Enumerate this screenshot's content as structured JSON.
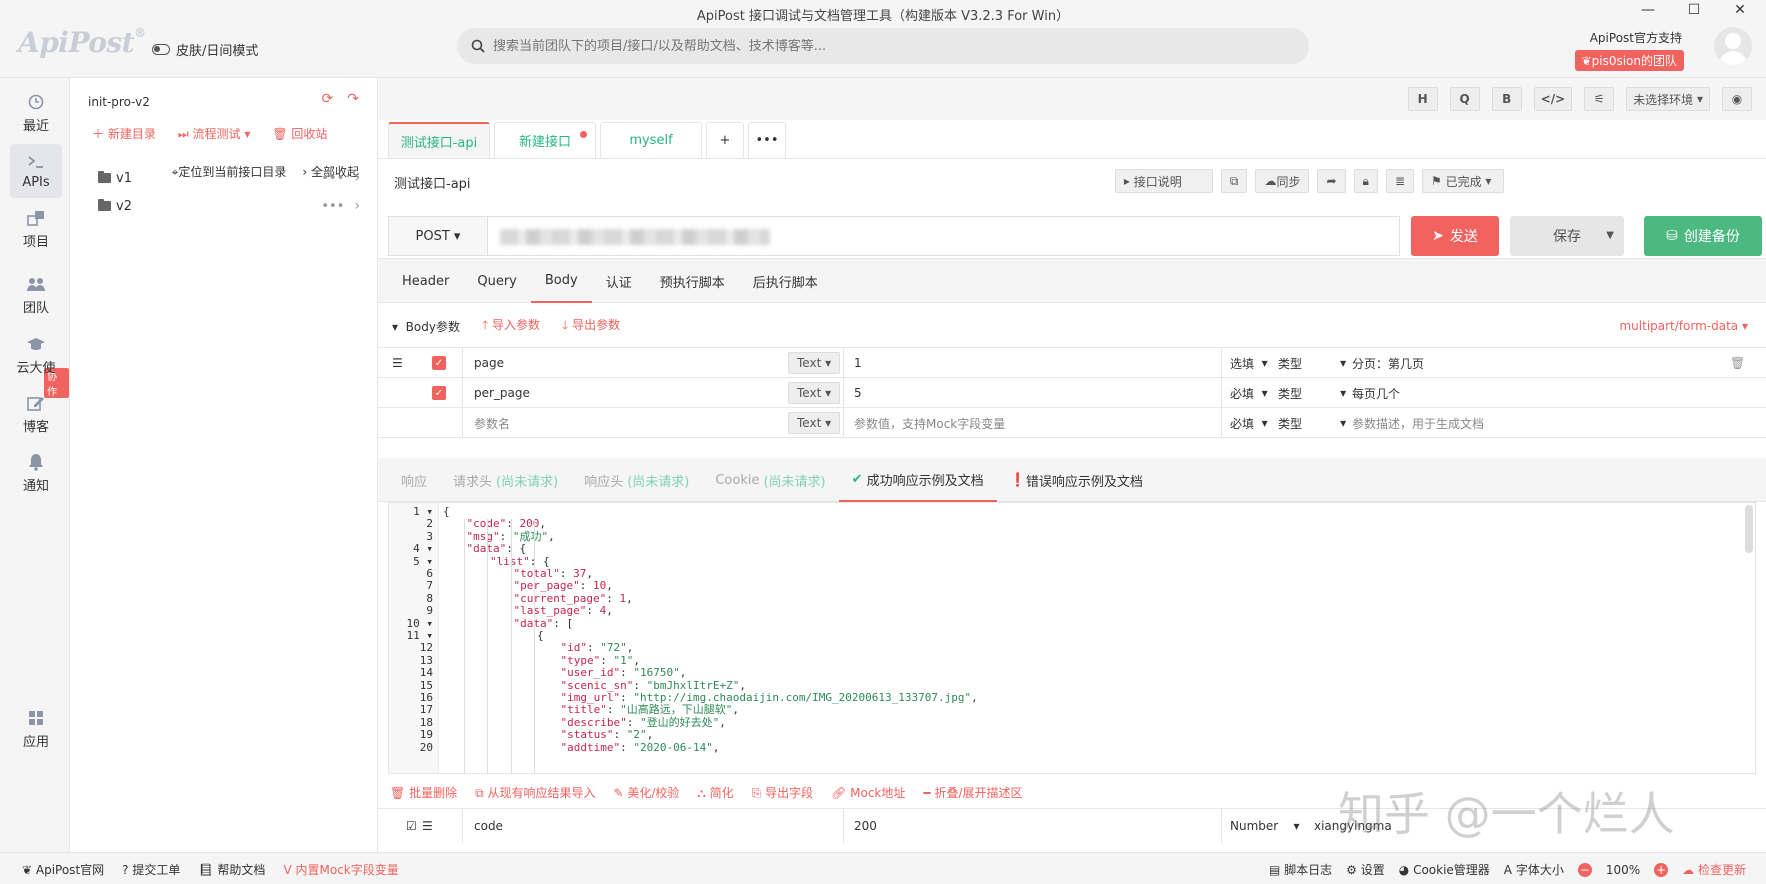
{
  "window": {
    "title": "ApiPost 接口调试与文档管理工具（构建版本 V3.2.3 For Win）",
    "controls": [
      "—",
      "☐",
      "✕"
    ]
  },
  "header": {
    "logo": "ApiPost",
    "logo_mark": "®",
    "theme_toggle": "皮肤/日间模式",
    "search_placeholder": "搜索当前团队下的项目/接口/以及帮助文档、技术博客等...",
    "support": "ApiPost官方支持",
    "team": "pis0sion的团队"
  },
  "leftnav": {
    "items": [
      {
        "label": "最近",
        "icon": "clock-icon"
      },
      {
        "label": "APIs",
        "icon": "terminal-icon"
      },
      {
        "label": "项目",
        "icon": "project-icon"
      },
      {
        "label": "团队",
        "icon": "team-icon"
      },
      {
        "label": "云大使",
        "icon": "graduation-icon"
      },
      {
        "label": "博客",
        "icon": "edit-icon"
      },
      {
        "label": "通知",
        "icon": "bell-icon"
      },
      {
        "label": "应用",
        "icon": "grid-icon"
      }
    ],
    "collab_badge": "协作"
  },
  "tree": {
    "project": "init-pro-v2",
    "actions": {
      "new_dir": "新建目录",
      "flow_test": "流程测试",
      "recycle": "回收站"
    },
    "locate": "定位到当前接口目录",
    "collapse_all": "全部收起",
    "folders": [
      "v1",
      "v2"
    ]
  },
  "main": {
    "toolbar": {
      "h": "H",
      "q": "Q",
      "b": "B",
      "code": "</>",
      "sliders": "⚟",
      "env": "未选择环境",
      "eye": "◉"
    },
    "tabs": [
      {
        "label": "测试接口-api"
      },
      {
        "label": "新建接口"
      },
      {
        "label": "myself"
      }
    ],
    "tab_add": "+",
    "tab_more": "•••",
    "api_title": "测试接口-api",
    "api_tools": {
      "desc": "接口说明",
      "sync": "同步",
      "status": "已完成"
    },
    "method": "POST",
    "send": "发送",
    "save": "保存",
    "backup": "创建备份",
    "subtabs": [
      "Header",
      "Query",
      "Body",
      "认证",
      "预执行脚本",
      "后执行脚本"
    ],
    "body_bar": {
      "params": "Body参数",
      "import": "导入参数",
      "export": "导出参数",
      "content_type": "multipart/form-data"
    },
    "params": [
      {
        "name": "page",
        "type": "Text",
        "value": "1",
        "required": "选填",
        "field_type": "类型",
        "desc": "分页：第几页"
      },
      {
        "name": "per_page",
        "type": "Text",
        "value": "5",
        "required": "必填",
        "field_type": "类型",
        "desc": "每页几个"
      },
      {
        "name": "参数名",
        "type": "Text",
        "value": "参数值，支持Mock字段变量",
        "required": "必填",
        "field_type": "类型",
        "desc": "参数描述，用于生成文档"
      }
    ],
    "resp_tabs": [
      {
        "label": "响应",
        "sub": ""
      },
      {
        "label": "请求头",
        "sub": "(尚未请求)"
      },
      {
        "label": "响应头",
        "sub": "(尚未请求)"
      },
      {
        "label": "Cookie",
        "sub": "(尚未请求)"
      },
      {
        "label": "成功响应示例及文档",
        "sub": ""
      },
      {
        "label": "错误响应示例及文档",
        "sub": ""
      }
    ],
    "code_lines": [
      {
        "n": "1",
        "fold": true,
        "d": 0,
        "k": "",
        "v": "",
        "raw": "{"
      },
      {
        "n": "2",
        "fold": false,
        "d": 1,
        "k": "\"code\"",
        "v": "200",
        "t": "n"
      },
      {
        "n": "3",
        "fold": false,
        "d": 1,
        "k": "\"msg\"",
        "v": "\"成功\"",
        "t": "s"
      },
      {
        "n": "4",
        "fold": true,
        "d": 1,
        "k": "\"data\"",
        "v": "{",
        "t": "p"
      },
      {
        "n": "5",
        "fold": true,
        "d": 2,
        "k": "\"list\"",
        "v": "{",
        "t": "p"
      },
      {
        "n": "6",
        "fold": false,
        "d": 3,
        "k": "\"total\"",
        "v": "37",
        "t": "n"
      },
      {
        "n": "7",
        "fold": false,
        "d": 3,
        "k": "\"per_page\"",
        "v": "10",
        "t": "n"
      },
      {
        "n": "8",
        "fold": false,
        "d": 3,
        "k": "\"current_page\"",
        "v": "1",
        "t": "n"
      },
      {
        "n": "9",
        "fold": false,
        "d": 3,
        "k": "\"last_page\"",
        "v": "4",
        "t": "n"
      },
      {
        "n": "10",
        "fold": true,
        "d": 3,
        "k": "\"data\"",
        "v": "[",
        "t": "p"
      },
      {
        "n": "11",
        "fold": true,
        "d": 4,
        "k": "",
        "v": "",
        "raw": "{"
      },
      {
        "n": "12",
        "fold": false,
        "d": 5,
        "k": "\"id\"",
        "v": "\"72\"",
        "t": "s"
      },
      {
        "n": "13",
        "fold": false,
        "d": 5,
        "k": "\"type\"",
        "v": "\"1\"",
        "t": "s"
      },
      {
        "n": "14",
        "fold": false,
        "d": 5,
        "k": "\"user_id\"",
        "v": "\"16750\"",
        "t": "s"
      },
      {
        "n": "15",
        "fold": false,
        "d": 5,
        "k": "\"scenic_sn\"",
        "v": "\"bmJhxlItrE+Z\"",
        "t": "s"
      },
      {
        "n": "16",
        "fold": false,
        "d": 5,
        "k": "\"img_url\"",
        "v": "\"http://img.chaodaijin.com/IMG_20200613_133707.jpg\"",
        "t": "s"
      },
      {
        "n": "17",
        "fold": false,
        "d": 5,
        "k": "\"title\"",
        "v": "\"山高路远，下山腿软\"",
        "t": "s"
      },
      {
        "n": "18",
        "fold": false,
        "d": 5,
        "k": "\"describe\"",
        "v": "\"登山的好去处\"",
        "t": "s"
      },
      {
        "n": "19",
        "fold": false,
        "d": 5,
        "k": "\"status\"",
        "v": "\"2\"",
        "t": "s"
      },
      {
        "n": "20",
        "fold": false,
        "d": 5,
        "k": "\"addtime\"",
        "v": "\"2020-06-14\"",
        "t": "s"
      }
    ],
    "resp_actions": [
      "批量删除",
      "从现有响应结果导入",
      "美化/校验",
      "简化",
      "导出字段",
      "Mock地址",
      "折叠/展开描述区"
    ],
    "resp_field": {
      "name": "code",
      "value": "200",
      "type": "Number",
      "desc": "xiangyingma"
    }
  },
  "watermark": "知乎 @一个烂人",
  "footer": {
    "left": [
      "ApiPost官网",
      "提交工单",
      "帮助文档",
      "内置Mock字段变量"
    ],
    "right": {
      "script_log": "脚本日志",
      "settings": "设置",
      "cookie": "Cookie管理器",
      "font": "字体大小",
      "zoom": "100%",
      "update": "检查更新"
    }
  }
}
